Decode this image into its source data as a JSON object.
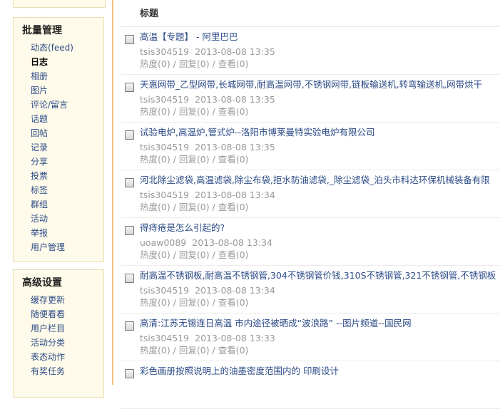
{
  "sidebar": {
    "batch": {
      "title": "批量管理",
      "items": [
        {
          "label": "动态(feed)"
        },
        {
          "label": "日志",
          "current": true
        },
        {
          "label": "相册"
        },
        {
          "label": "图片"
        },
        {
          "label": "评论/留言"
        },
        {
          "label": "话题"
        },
        {
          "label": "回帖"
        },
        {
          "label": "记录"
        },
        {
          "label": "分享"
        },
        {
          "label": "投票"
        },
        {
          "label": "标签"
        },
        {
          "label": "群组"
        },
        {
          "label": "活动"
        },
        {
          "label": "举报"
        },
        {
          "label": "用户管理"
        }
      ]
    },
    "advanced": {
      "title": "高级设置",
      "items": [
        {
          "label": "缓存更新"
        },
        {
          "label": "随便看看"
        },
        {
          "label": "用户栏目"
        },
        {
          "label": "活动分类"
        },
        {
          "label": "表态动作"
        },
        {
          "label": "有奖任务"
        }
      ]
    }
  },
  "list": {
    "header": "标题",
    "entries": [
      {
        "title": "高温【专题】 - 阿里巴巴",
        "user": "tsis304519",
        "time": "2013-08-08 13:35",
        "stats": "热度(0) / 回复(0) / 查看(0)"
      },
      {
        "title": "天惠网带_乙型网带,长城网带,耐高温网带,不锈钢网带,链板输送机,转弯输送机,网带烘干",
        "user": "tsis304519",
        "time": "2013-08-08 13:35",
        "stats": "热度(0) / 回复(0) / 查看(0)"
      },
      {
        "title": "试验电炉,高温炉,管式炉--洛阳市博莱曼特实验电炉有限公司",
        "user": "tsis304519",
        "time": "2013-08-08 13:35",
        "stats": "热度(0) / 回复(0) / 查看(0)"
      },
      {
        "title": "河北除尘滤袋,高温滤袋,除尘布袋,拒水防油滤袋,_除尘滤袋_泊头市科达环保机械装备有限",
        "user": "tsis304519",
        "time": "2013-08-08 13:34",
        "stats": "热度(0) / 回复(0) / 查看(0)"
      },
      {
        "title": "得痔疮是怎么引起的?",
        "user": "uoaw0089",
        "time": "2013-08-08 13:34",
        "stats": "热度(0) / 回复(0) / 查看(0)"
      },
      {
        "title": "耐高温不锈钢板,耐高温不锈钢管,304不锈钢管价钱,310S不锈钢管,321不锈钢管,不锈钢板",
        "user": "tsis304519",
        "time": "2013-08-08 13:34",
        "stats": "热度(0) / 回复(0) / 查看(0)"
      },
      {
        "title": "高清:江苏无锡连日高温 市内途径被晒成“波浪路” --图片频道--国民网",
        "user": "tsis304519",
        "time": "2013-08-08 13:33",
        "stats": "热度(0) / 回复(0) / 查看(0)"
      },
      {
        "title": "彩色画册按照说明上的油墨密度范围内的 印刷设计",
        "user": "",
        "time": "",
        "stats": ""
      }
    ]
  }
}
